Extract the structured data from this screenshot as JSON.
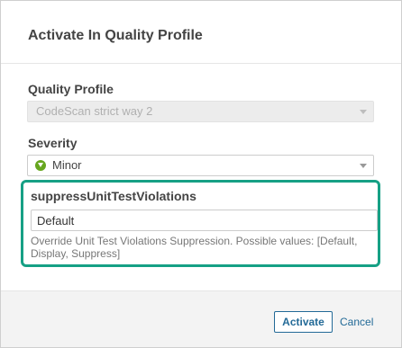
{
  "dialog": {
    "title": "Activate In Quality Profile"
  },
  "quality_profile": {
    "label": "Quality Profile",
    "selected": "CodeScan strict way 2",
    "disabled": true
  },
  "severity": {
    "label": "Severity",
    "selected": "Minor",
    "icon": "minor-severity-icon",
    "icon_color": "#66a61e"
  },
  "parameter": {
    "name": "suppressUnitTestViolations",
    "value": "Default",
    "description": "Override Unit Test Violations Suppression. Possible values: [Default, Display, Suppress]",
    "highlight_color": "#16a085"
  },
  "footer": {
    "activate_label": "Activate",
    "cancel_label": "Cancel",
    "link_color": "#236a97"
  }
}
